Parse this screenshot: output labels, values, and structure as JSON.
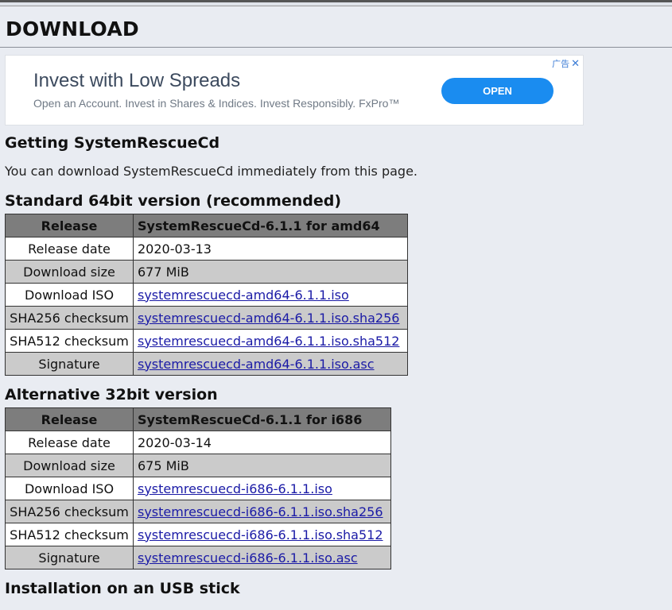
{
  "page": {
    "title": "DOWNLOAD"
  },
  "ad": {
    "headline": "Invest with Low Spreads",
    "body": "Open an Account. Invest in Shares & Indices. Invest Responsibly. FxPro™",
    "cta": "OPEN",
    "choices_label": "广告",
    "close_glyph": "✕",
    "colors": {
      "cta": "#1a8cf0"
    }
  },
  "getting": {
    "heading": "Getting SystemRescueCd",
    "intro": "You can download SystemRescueCd immediately from this page."
  },
  "standard": {
    "heading": "Standard 64bit version (recommended)",
    "header": {
      "label": "Release",
      "value": "SystemRescueCd-6.1.1 for amd64"
    },
    "rows": [
      {
        "label": "Release date",
        "value": "2020-03-13",
        "link": false
      },
      {
        "label": "Download size",
        "value": "677 MiB",
        "link": false
      },
      {
        "label": "Download ISO",
        "value": "systemrescuecd-amd64-6.1.1.iso",
        "link": true
      },
      {
        "label": "SHA256 checksum",
        "value": "systemrescuecd-amd64-6.1.1.iso.sha256",
        "link": true
      },
      {
        "label": "SHA512 checksum",
        "value": "systemrescuecd-amd64-6.1.1.iso.sha512",
        "link": true
      },
      {
        "label": "Signature",
        "value": "systemrescuecd-amd64-6.1.1.iso.asc",
        "link": true
      }
    ]
  },
  "alternative": {
    "heading": "Alternative 32bit version",
    "header": {
      "label": "Release",
      "value": "SystemRescueCd-6.1.1 for i686"
    },
    "rows": [
      {
        "label": "Release date",
        "value": "2020-03-14",
        "link": false
      },
      {
        "label": "Download size",
        "value": "675 MiB",
        "link": false
      },
      {
        "label": "Download ISO",
        "value": "systemrescuecd-i686-6.1.1.iso",
        "link": true
      },
      {
        "label": "SHA256 checksum",
        "value": "systemrescuecd-i686-6.1.1.iso.sha256",
        "link": true
      },
      {
        "label": "SHA512 checksum",
        "value": "systemrescuecd-i686-6.1.1.iso.sha512",
        "link": true
      },
      {
        "label": "Signature",
        "value": "systemrescuecd-i686-6.1.1.iso.asc",
        "link": true
      }
    ]
  },
  "installation": {
    "heading": "Installation on an USB stick"
  }
}
